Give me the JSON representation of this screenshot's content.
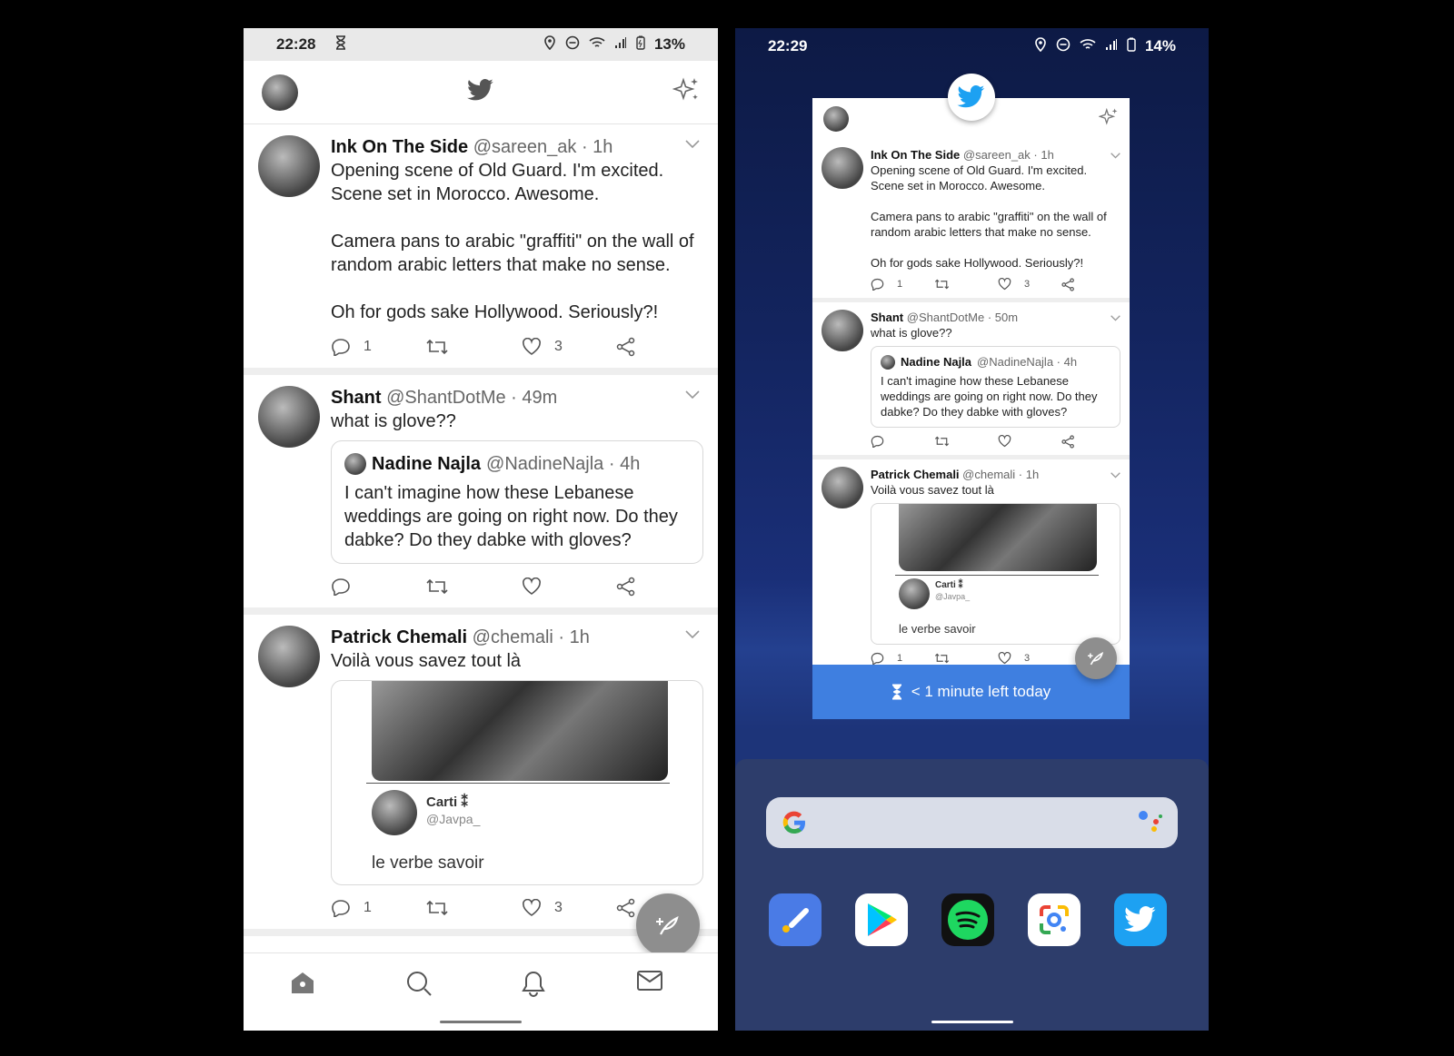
{
  "left": {
    "status": {
      "time": "22:28",
      "battery": "13%"
    },
    "tweets": [
      {
        "name": "Ink On The Side",
        "handle": "@sareen_ak · 1h",
        "text": "Opening scene of Old Guard. I'm excited.\nScene set in Morocco. Awesome.\n\nCamera pans to arabic \"graffiti\" on the wall of random arabic letters that make no sense.\n\nOh for gods sake Hollywood. Seriously?!",
        "replies": "1",
        "likes": "3"
      },
      {
        "name": "Shant",
        "handle": "@ShantDotMe · 49m",
        "text": "what is glove??",
        "quote": {
          "name": "Nadine Najla",
          "handle": "@NadineNajla · 4h",
          "text": "I can't imagine how these Lebanese weddings are going on right now. Do they dabke? Do they dabke with gloves?"
        },
        "replies": "",
        "likes": ""
      },
      {
        "name": "Patrick Chemali",
        "handle": "@chemali · 1h",
        "text": "Voilà vous savez tout là",
        "media": {
          "name": "Carti ⁑",
          "handle": "@Javpa_",
          "caption": "le verbe savoir"
        },
        "replies": "1",
        "likes": "3"
      }
    ]
  },
  "right": {
    "status": {
      "time": "22:29",
      "battery": "14%"
    },
    "tweets": [
      {
        "name": "Ink On The Side",
        "handle": "@sareen_ak · 1h",
        "text": "Opening scene of Old Guard. I'm excited.\nScene set in Morocco. Awesome.\n\nCamera pans to arabic \"graffiti\" on the wall of random arabic letters that make no sense.\n\nOh for gods sake Hollywood. Seriously?!",
        "replies": "1",
        "likes": "3"
      },
      {
        "name": "Shant",
        "handle": "@ShantDotMe · 50m",
        "text": "what is glove??",
        "quote": {
          "name": "Nadine Najla",
          "handle": "@NadineNajla · 4h",
          "text": "I can't imagine how these Lebanese weddings are going on right now. Do they dabke? Do they dabke with gloves?"
        },
        "replies": "",
        "likes": ""
      },
      {
        "name": "Patrick Chemali",
        "handle": "@chemali · 1h",
        "text": "Voilà vous savez tout là",
        "media": {
          "name": "Carti ⁑",
          "handle": "@Javpa_",
          "caption": "le verbe savoir"
        },
        "replies": "1",
        "likes": "3"
      }
    ],
    "timer_banner": "< 1 minute left today",
    "dock": [
      "tasks-app",
      "play-store",
      "spotify",
      "google-lens",
      "twitter"
    ]
  },
  "colors": {
    "twitter_blue": "#1da1f2",
    "banner_blue": "#3f7fe0",
    "dock_bg": "#2d3d6b"
  }
}
